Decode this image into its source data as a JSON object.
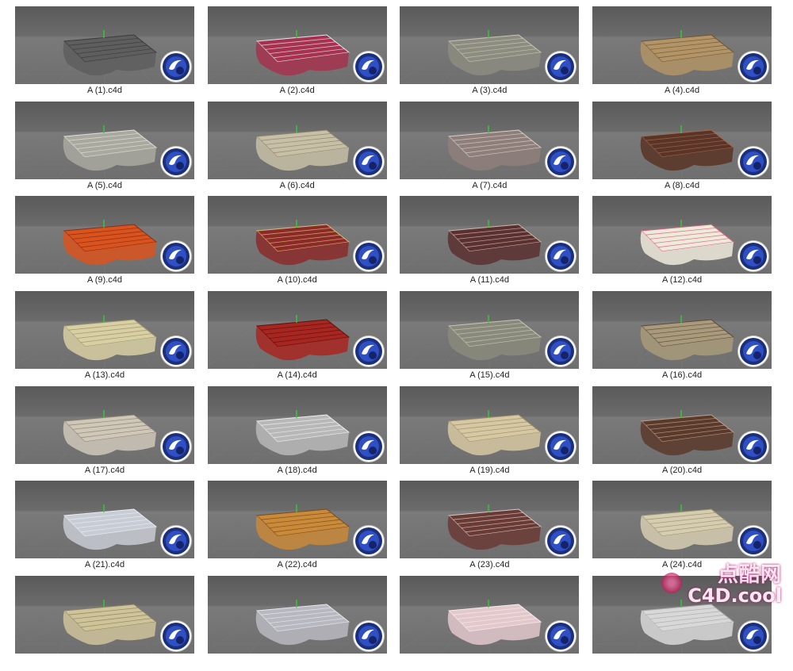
{
  "files": [
    {
      "name": "A (1).c4d",
      "fabric": "#5e5e5e",
      "accent": "#3a3a3a"
    },
    {
      "name": "A (2).c4d",
      "fabric": "#a6324f",
      "accent": "#e7e7f0"
    },
    {
      "name": "A (3).c4d",
      "fabric": "#8c8c80",
      "accent": "#c9c6b2"
    },
    {
      "name": "A (4).c4d",
      "fabric": "#b39466",
      "accent": "#6b5436"
    },
    {
      "name": "A (5).c4d",
      "fabric": "#a9a9a0",
      "accent": "#e0e0d8"
    },
    {
      "name": "A (6).c4d",
      "fabric": "#c7bfa6",
      "accent": "#8a826a"
    },
    {
      "name": "A (7).c4d",
      "fabric": "#8f7f7a",
      "accent": "#d8d0cc"
    },
    {
      "name": "A (8).c4d",
      "fabric": "#5a3426",
      "accent": "#a06a50"
    },
    {
      "name": "A (9).c4d",
      "fabric": "#d9531f",
      "accent": "#8a2a10"
    },
    {
      "name": "A (10).c4d",
      "fabric": "#8c2a2a",
      "accent": "#d8c070"
    },
    {
      "name": "A (11).c4d",
      "fabric": "#5a3030",
      "accent": "#d0b8a8"
    },
    {
      "name": "A (12).c4d",
      "fabric": "#eeeada",
      "accent": "#d85a80"
    },
    {
      "name": "A (13).c4d",
      "fabric": "#d8cfa2",
      "accent": "#9a9070"
    },
    {
      "name": "A (14).c4d",
      "fabric": "#a82620",
      "accent": "#5a1010"
    },
    {
      "name": "A (15).c4d",
      "fabric": "#8a8a7c",
      "accent": "#c8c8b8"
    },
    {
      "name": "A (16).c4d",
      "fabric": "#a89a7a",
      "accent": "#5a4a3a"
    },
    {
      "name": "A (17).c4d",
      "fabric": "#cfc7b8",
      "accent": "#8a8070"
    },
    {
      "name": "A (18).c4d",
      "fabric": "#b8b8b8",
      "accent": "#f0f0f0"
    },
    {
      "name": "A (19).c4d",
      "fabric": "#d6c8a2",
      "accent": "#9a8a66"
    },
    {
      "name": "A (20).c4d",
      "fabric": "#5a3a2a",
      "accent": "#c0a090"
    },
    {
      "name": "A (21).c4d",
      "fabric": "#c8ccd4",
      "accent": "#e8eef4"
    },
    {
      "name": "A (22).c4d",
      "fabric": "#c98a3a",
      "accent": "#7a4a1a"
    },
    {
      "name": "A (23).c4d",
      "fabric": "#6a3a34",
      "accent": "#d8c8c8"
    },
    {
      "name": "A (24).c4d",
      "fabric": "#d6cdb0",
      "accent": "#968c70"
    },
    {
      "name": "",
      "fabric": "#cfc39a",
      "accent": "#8a8060"
    },
    {
      "name": "",
      "fabric": "#b8b8c0",
      "accent": "#e8e8f0"
    },
    {
      "name": "",
      "fabric": "#e3c8cc",
      "accent": "#f8eef0"
    },
    {
      "name": "",
      "fabric": "#d8d8d8",
      "accent": "#a8a8a8"
    }
  ],
  "watermark": {
    "cn": "点酷网",
    "en": "C4D.cool",
    "color": "#c2185b"
  }
}
